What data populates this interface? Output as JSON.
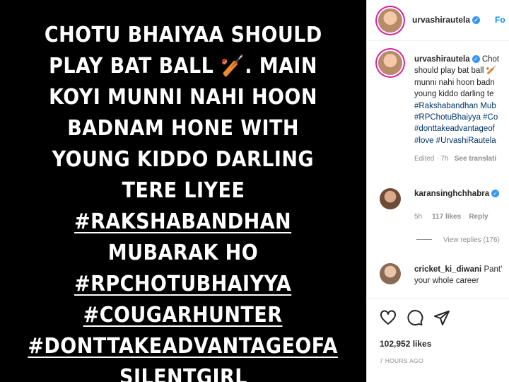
{
  "post": {
    "story_lines": [
      "CHOTU BHAIYAA SHOULD",
      "PLAY BAT BALL 🏏. MAIN",
      "KOYI MUNNI NAHI HOON",
      "BADNAM HONE WITH",
      "YOUNG KIDDO DARLING",
      "TERE LIYEE"
    ],
    "tags": [
      "#RAKSHABANDHAN",
      "#RPCHOTUBHAIYYA",
      "#COUGARHUNTER",
      "#DONTTAKEADVANTAGEOFA"
    ],
    "mid_line": "MUBARAK HO",
    "cut_line": "SILENTGIRL"
  },
  "header": {
    "username": "urvashirautela",
    "follow_label": "Fo"
  },
  "caption": {
    "username": "urvashirautela",
    "first_text": "Chot",
    "lines": [
      "should play bat ball 🏏",
      "munni nahi hoon badn",
      "young kiddo darling te"
    ],
    "tag_lines": [
      "#Rakshabandhan Mub",
      "#RPChotuBhaiyya #Co",
      "#donttakeadvantageof",
      "#love #UrvashiRautela"
    ],
    "edited": "Edited · 7h",
    "see_translation": "See translati"
  },
  "comments": [
    {
      "username": "karansinghchhabra",
      "time": "5h",
      "likes": "117 likes",
      "reply": "Reply"
    },
    {
      "username": "cricket_ki_diwani",
      "text": "Pant'",
      "line2": "your whole career"
    }
  ],
  "view_replies": "View replies (176)",
  "footer": {
    "likes": "102,952 likes",
    "time": "7 HOURS AGO"
  }
}
